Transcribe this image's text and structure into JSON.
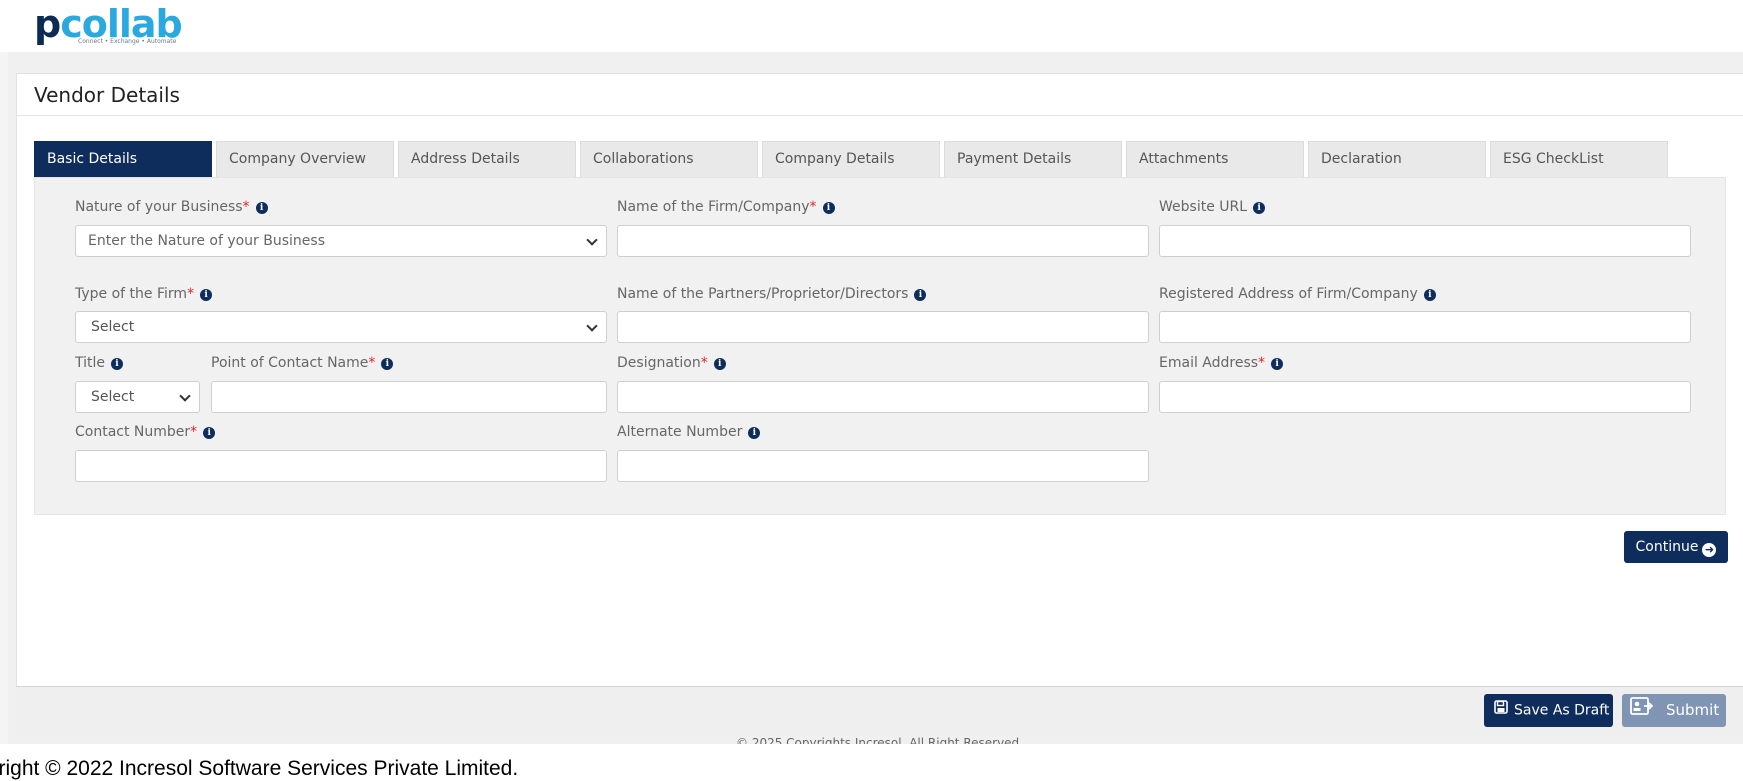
{
  "brand": {
    "logo_text_p": "p",
    "logo_text_rest": "collab",
    "tagline": "Connect • Exchange • Automate"
  },
  "page": {
    "title": "Vendor Details"
  },
  "tabs": [
    {
      "label": "Basic Details",
      "active": true
    },
    {
      "label": "Company Overview",
      "active": false
    },
    {
      "label": "Address Details",
      "active": false
    },
    {
      "label": "Collaborations",
      "active": false
    },
    {
      "label": "Company Details",
      "active": false
    },
    {
      "label": "Payment Details",
      "active": false
    },
    {
      "label": "Attachments",
      "active": false
    },
    {
      "label": "Declaration",
      "active": false
    },
    {
      "label": "ESG CheckList",
      "active": false
    }
  ],
  "form": {
    "nature_of_business": {
      "label": "Nature of your Business",
      "required": "*",
      "placeholder": "Enter the Nature of your Business"
    },
    "firm_name": {
      "label": "Name of the Firm/Company",
      "required": "*",
      "value": ""
    },
    "website_url": {
      "label": "Website URL",
      "value": ""
    },
    "firm_type": {
      "label": "Type of the Firm",
      "required": "*",
      "selected": "Select"
    },
    "partners": {
      "label": "Name of the Partners/Proprietor/Directors",
      "value": ""
    },
    "registered_address": {
      "label": "Registered Address of Firm/Company",
      "value": ""
    },
    "title": {
      "label": "Title",
      "selected": "Select"
    },
    "contact_name": {
      "label": "Point of Contact Name",
      "required": "*",
      "value": ""
    },
    "designation": {
      "label": "Designation",
      "required": "*",
      "value": ""
    },
    "email": {
      "label": "Email Address",
      "required": "*",
      "value": ""
    },
    "contact_number": {
      "label": "Contact Number",
      "required": "*",
      "value": ""
    },
    "alternate_number": {
      "label": "Alternate Number",
      "value": ""
    }
  },
  "actions": {
    "continue_label": "Continue",
    "save_draft_label": "Save As Draft",
    "submit_label": "Submit"
  },
  "footer": {
    "inner_copyright": "© 2025 Copyrights Incresol. All Right Reserved.",
    "copyright": "yright © 2022 Incresol Software Services Private Limited."
  },
  "colors": {
    "primary": "#0e2d5c",
    "required": "#e0262b",
    "submit_disabled": "#7f95b3",
    "logo_blue": "#2aa9e0"
  },
  "icons": {
    "info": "info-circle-icon",
    "chevron": "chevron-down-icon",
    "continue": "arrow-circle-right-icon",
    "save": "floppy-disk-icon",
    "submit": "id-card-submit-icon"
  }
}
